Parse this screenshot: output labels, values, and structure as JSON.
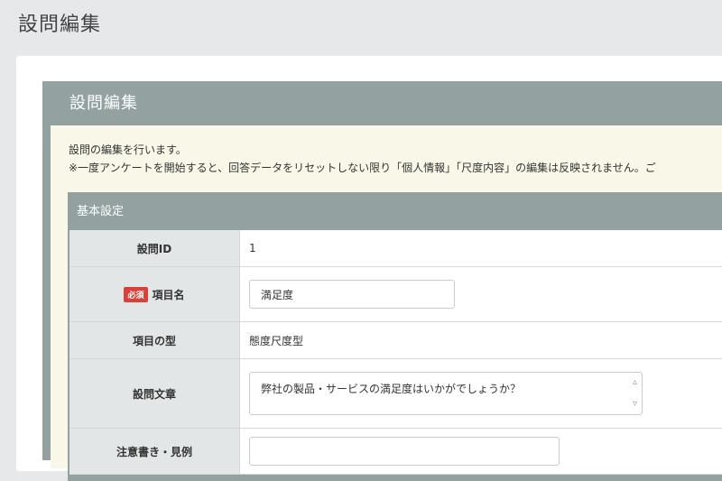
{
  "page": {
    "title": "設問編集"
  },
  "panel": {
    "title": "設問編集",
    "desc_line1": "設問の編集を行います。",
    "desc_line2": "※一度アンケートを開始すると、回答データをリセットしない限り「個人情報」「尺度内容」の編集は反映されません。ご"
  },
  "section": {
    "title": "基本設定",
    "rows": {
      "id": {
        "label": "設問ID",
        "value": "1"
      },
      "name": {
        "badge": "必須",
        "label": "項目名",
        "value": "満足度"
      },
      "type": {
        "label": "項目の型",
        "value": "態度尺度型"
      },
      "text": {
        "label": "設問文章",
        "value": "弊社の製品・サービスの満足度はいかがでしょうか？"
      },
      "note": {
        "label": "注意書き・見例"
      }
    }
  },
  "icons": {
    "scroll_up": "chevron-up-icon",
    "scroll_down": "chevron-down-icon"
  },
  "colors": {
    "panel_header": "#93a2a1",
    "panel_body": "#f9f8e8",
    "label_cell": "#e3e6e6",
    "required_badge": "#d9403a"
  }
}
